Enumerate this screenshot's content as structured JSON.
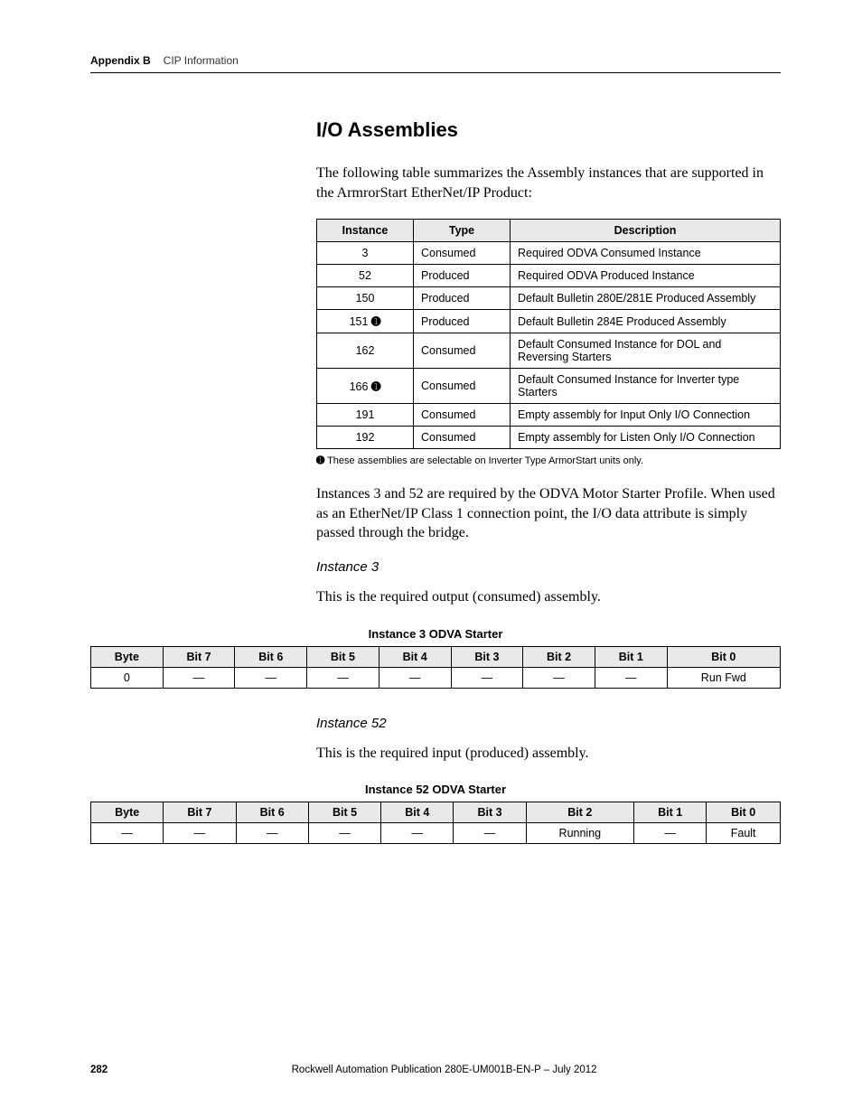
{
  "header": {
    "appendix": "Appendix B",
    "chapter": "CIP Information"
  },
  "section": {
    "title": "I/O Assemblies",
    "intro": "The following table summarizes the Assembly instances that are supported in the ArmrorStart EtherNet/IP Product:"
  },
  "assemblies_table": {
    "headers": [
      "Instance",
      "Type",
      "Description"
    ],
    "rows": [
      {
        "instance": "3",
        "marker": "",
        "type": "Consumed",
        "desc": "Required ODVA Consumed Instance"
      },
      {
        "instance": "52",
        "marker": "",
        "type": "Produced",
        "desc": "Required ODVA Produced Instance"
      },
      {
        "instance": "150",
        "marker": "",
        "type": "Produced",
        "desc": "Default Bulletin 280E/281E Produced Assembly"
      },
      {
        "instance": "151",
        "marker": "➊",
        "type": "Produced",
        "desc": "Default Bulletin 284E Produced Assembly"
      },
      {
        "instance": "162",
        "marker": "",
        "type": "Consumed",
        "desc": "Default Consumed Instance for DOL and Reversing Starters"
      },
      {
        "instance": "166",
        "marker": "➊",
        "type": "Consumed",
        "desc": "Default Consumed Instance for Inverter type Starters"
      },
      {
        "instance": "191",
        "marker": "",
        "type": "Consumed",
        "desc": "Empty assembly for Input Only I/O Connection"
      },
      {
        "instance": "192",
        "marker": "",
        "type": "Consumed",
        "desc": "Empty assembly for Listen Only I/O Connection"
      }
    ]
  },
  "footnote": {
    "marker": "➊",
    "text": "These assemblies are selectable on Inverter Type ArmorStart units only."
  },
  "paragraph2": "Instances 3 and 52 are required by the ODVA Motor Starter Profile. When used as an EtherNet/IP Class 1 connection point, the I/O data attribute is simply passed through the bridge.",
  "instance3": {
    "heading": "Instance 3",
    "text": "This is the required output (consumed) assembly.",
    "table_title": "Instance 3 ODVA Starter",
    "bit_headers": [
      "Byte",
      "Bit 7",
      "Bit 6",
      "Bit 5",
      "Bit 4",
      "Bit 3",
      "Bit 2",
      "Bit 1",
      "Bit 0"
    ],
    "row": [
      "0",
      "—",
      "—",
      "—",
      "—",
      "—",
      "—",
      "—",
      "Run Fwd"
    ]
  },
  "instance52": {
    "heading": "Instance 52",
    "text": "This is the required input (produced) assembly.",
    "table_title": "Instance 52 ODVA Starter",
    "bit_headers": [
      "Byte",
      "Bit 7",
      "Bit 6",
      "Bit 5",
      "Bit 4",
      "Bit 3",
      "Bit 2",
      "Bit 1",
      "Bit 0"
    ],
    "row": [
      "—",
      "—",
      "—",
      "—",
      "—",
      "—",
      "Running",
      "—",
      "Fault"
    ]
  },
  "footer": {
    "page": "282",
    "publication": "Rockwell Automation Publication 280E-UM001B-EN-P – July 2012"
  }
}
